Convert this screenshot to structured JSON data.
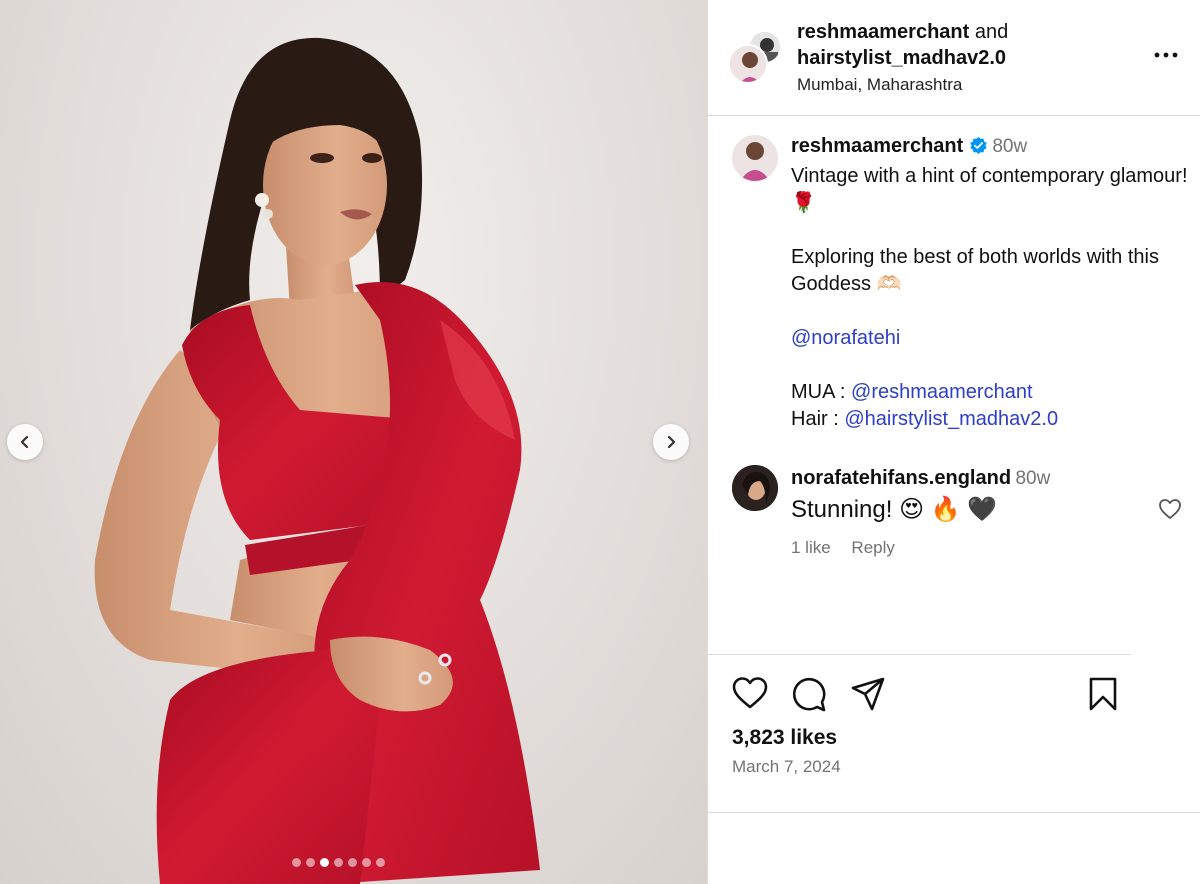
{
  "header": {
    "author": "reshmaamerchant",
    "and_text": "and",
    "coauthor": "hairstylist_madhav2.0",
    "location": "Mumbai, Maharashtra"
  },
  "caption": {
    "username": "reshmaamerchant",
    "time": "80w",
    "line1": "Vintage with a hint of contemporary glamour! 🌹",
    "line2": "Exploring the best of both worlds with this Goddess 🫶🏻",
    "mention": "@norafatehi",
    "mua_label": "MUA : ",
    "mua_mention": "@reshmaamerchant",
    "hair_label": "Hair : ",
    "hair_mention": "@hairstylist_madhav2.0"
  },
  "comment": {
    "username": "norafatehifans.england",
    "time": "80w",
    "text": "Stunning! 😍 🔥 🖤",
    "likes": "1 like",
    "reply": "Reply"
  },
  "post": {
    "likes": "3,823 likes",
    "date": "March 7, 2024"
  },
  "carousel": {
    "total_dots": 7,
    "active_index": 2
  },
  "colors": {
    "mention": "#2d3ec9",
    "muted": "#737373",
    "verified": "#0095f6",
    "dress": "#c8102e"
  }
}
